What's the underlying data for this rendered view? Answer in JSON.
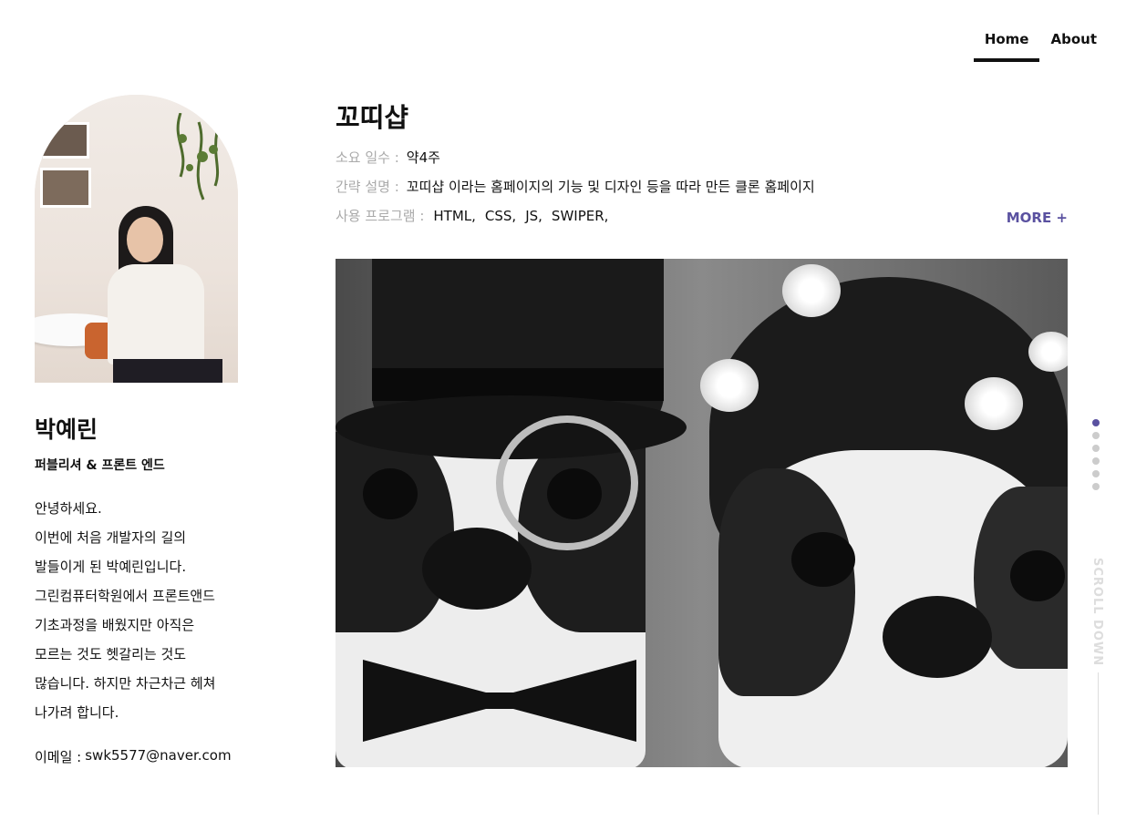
{
  "nav": {
    "items": [
      {
        "label": "Home",
        "active": true
      },
      {
        "label": "About",
        "active": false
      }
    ]
  },
  "profile": {
    "name": "박예린",
    "role": "퍼블리셔 & 프론트 엔드",
    "intro": [
      "안녕하세요.",
      "이번에 처음 개발자의 길의",
      "발들이게 된 박예린입니다.",
      "그린컴퓨터학원에서 프론트앤드",
      "기초과정을 배웠지만 아직은",
      "모르는 것도 헷갈리는 것도",
      "많습니다. 하지만 차근차근 헤쳐",
      "나가려 합니다."
    ],
    "email_label": "이메일 :",
    "email": "swk5577@naver.com"
  },
  "project": {
    "title": "꼬띠샵",
    "duration_label": "소요 일수 :",
    "duration": "약4주",
    "description_label": "간략 설명 :",
    "description": "꼬띠샵 이라는 홈페이지의 기능 및 디자인 등을 따라 만든 클론 홈페이지",
    "tech_label": "사용 프로그램 :",
    "tech": [
      "HTML,",
      "CSS,",
      "JS,",
      "SWIPER,"
    ],
    "more_label": "MORE +"
  },
  "scroll": {
    "label": "SCROLL DOWN",
    "dots_total": 6,
    "active_dot": 1
  },
  "colors": {
    "accent": "#5a51a0",
    "muted": "#aaaaaa"
  }
}
